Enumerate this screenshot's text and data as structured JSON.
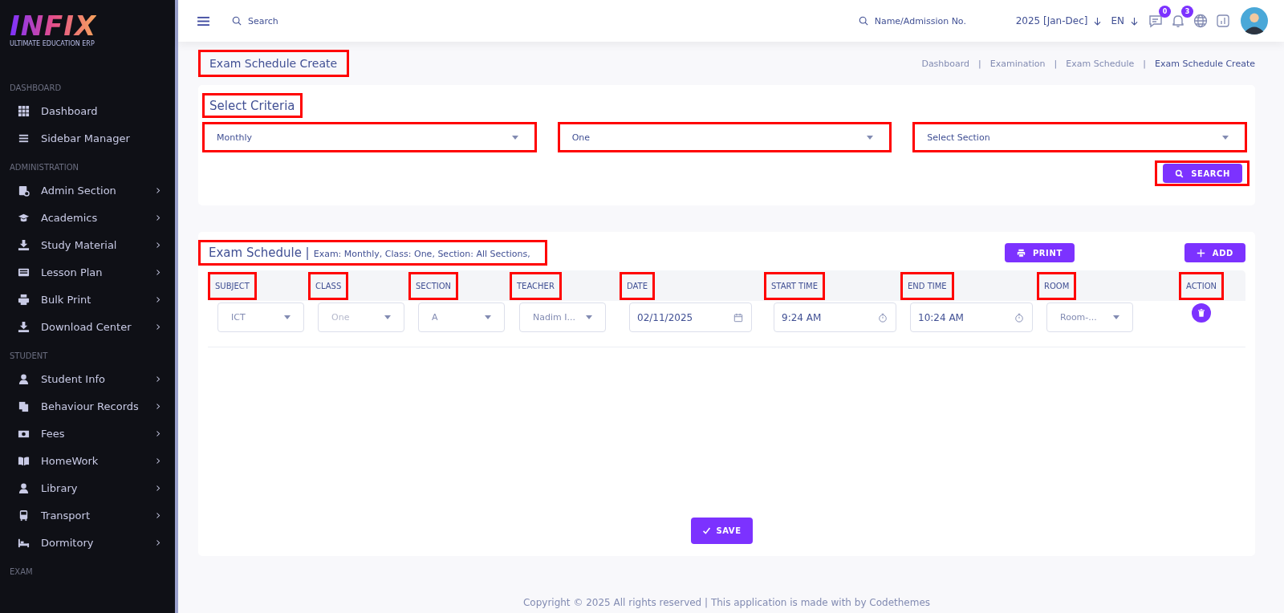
{
  "logo": {
    "name": "INFIX",
    "tagline": "ULTIMATE EDUCATION ERP"
  },
  "sidebar": {
    "sections": [
      {
        "heading": "DASHBOARD",
        "items": [
          {
            "label": "Dashboard",
            "has_submenu": false
          },
          {
            "label": "Sidebar Manager",
            "has_submenu": false
          }
        ]
      },
      {
        "heading": "ADMINISTRATION",
        "items": [
          {
            "label": "Admin Section",
            "has_submenu": true
          },
          {
            "label": "Academics",
            "has_submenu": true
          },
          {
            "label": "Study Material",
            "has_submenu": true
          },
          {
            "label": "Lesson Plan",
            "has_submenu": true
          },
          {
            "label": "Bulk Print",
            "has_submenu": true
          },
          {
            "label": "Download Center",
            "has_submenu": true
          }
        ]
      },
      {
        "heading": "STUDENT",
        "items": [
          {
            "label": "Student Info",
            "has_submenu": true
          },
          {
            "label": "Behaviour Records",
            "has_submenu": true
          },
          {
            "label": "Fees",
            "has_submenu": true
          },
          {
            "label": "HomeWork",
            "has_submenu": true
          },
          {
            "label": "Library",
            "has_submenu": true
          },
          {
            "label": "Transport",
            "has_submenu": true
          },
          {
            "label": "Dormitory",
            "has_submenu": true
          }
        ]
      },
      {
        "heading": "EXAM"
      }
    ]
  },
  "topbar": {
    "search": {
      "placeholder": "Search"
    },
    "student_search": {
      "placeholder": "Name/Admission No."
    },
    "session": "2025 [Jan-Dec]",
    "language": "EN",
    "message_count": "0",
    "notification_count": "3"
  },
  "page_title": {
    "text": "Exam Schedule Create",
    "highlighted": true
  },
  "breadcrumb": {
    "separator": "|",
    "items": [
      {
        "label": "Dashboard",
        "current": false
      },
      {
        "label": "Examination",
        "current": false
      },
      {
        "label": "Exam Schedule",
        "current": false
      },
      {
        "label": "Exam Schedule Create",
        "current": true
      }
    ]
  },
  "criteria": {
    "title": "Select Criteria",
    "highlighted": true,
    "selects": [
      {
        "value": "Monthly",
        "highlighted": true
      },
      {
        "value": "One",
        "highlighted": true
      },
      {
        "value": "Select Section",
        "highlighted": true
      }
    ],
    "search_button": {
      "label": "SEARCH",
      "highlighted": true
    }
  },
  "schedule": {
    "title": "Exam Schedule |",
    "details": "Exam: Monthly, Class: One, Section: All Sections,",
    "highlighted": true,
    "print_button": "PRINT",
    "add_button": "ADD",
    "columns": [
      {
        "label": "SUBJECT",
        "highlighted": true
      },
      {
        "label": "CLASS",
        "highlighted": true
      },
      {
        "label": "SECTION",
        "highlighted": true
      },
      {
        "label": "TEACHER",
        "highlighted": true
      },
      {
        "label": "DATE",
        "highlighted": true
      },
      {
        "label": "START TIME",
        "highlighted": true
      },
      {
        "label": "END TIME",
        "highlighted": true
      },
      {
        "label": "ROOM",
        "highlighted": true
      },
      {
        "label": "ACTION",
        "highlighted": true
      }
    ],
    "rows": [
      {
        "cells": [
          {
            "kind": "select",
            "value": "ICT",
            "disabled": false
          },
          {
            "kind": "select",
            "value": "One",
            "disabled": true
          },
          {
            "kind": "select",
            "value": "A",
            "disabled": false
          },
          {
            "kind": "select",
            "value": "Nadim I...",
            "disabled": false
          },
          {
            "kind": "date",
            "value": "02/11/2025",
            "disabled": false
          },
          {
            "kind": "time",
            "value": "9:24 AM",
            "disabled": false
          },
          {
            "kind": "time",
            "value": "10:24 AM",
            "disabled": false
          },
          {
            "kind": "select",
            "value": "Room-...",
            "disabled": false
          },
          {
            "kind": "delete",
            "disabled": false
          }
        ]
      }
    ],
    "save_button": "SAVE"
  },
  "footer": "Copyright © 2025 All rights reserved | This application is made with by Codethemes"
}
